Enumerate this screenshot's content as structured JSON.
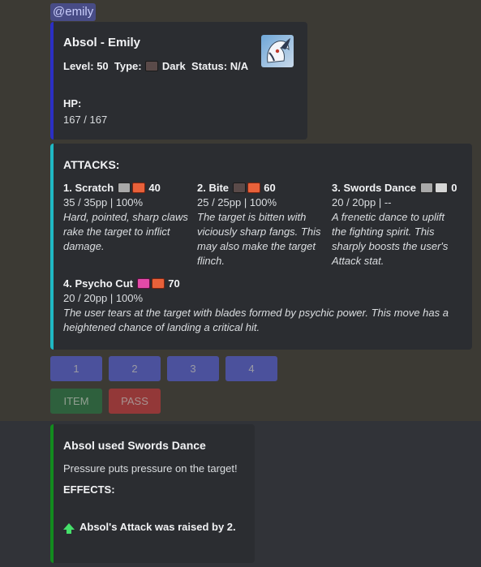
{
  "mention": "@emily",
  "status_card": {
    "title": "Absol - Emily",
    "level_label": "Level:",
    "level_value": "50",
    "type_label": "Type:",
    "type_value": "Dark",
    "status_label": "Status:",
    "status_value": "N/A",
    "hp_label": "HP:",
    "hp_value": "167 / 167"
  },
  "attacks_card": {
    "heading": "ATTACKS:",
    "attacks": [
      {
        "title": "1. Scratch",
        "power": "40",
        "pp": "35 / 35pp | 100%",
        "desc": "Hard, pointed, sharp claws rake the target to inflict damage.",
        "type_icon": "normal-type-icon",
        "category_icon": "physical-category-icon"
      },
      {
        "title": "2. Bite",
        "power": "60",
        "pp": "25 / 25pp | 100%",
        "desc": "The target is bitten with viciously sharp fangs. This may also make the target flinch.",
        "type_icon": "dark-type-icon",
        "category_icon": "physical-category-icon"
      },
      {
        "title": "3. Swords Dance",
        "power": "0",
        "pp": "20 / 20pp | --",
        "desc": "A frenetic dance to uplift the fighting spirit. This sharply boosts the user's Attack stat.",
        "type_icon": "normal-type-icon",
        "category_icon": "status-category-icon"
      },
      {
        "title": "4. Psycho Cut",
        "power": "70",
        "pp": "20 / 20pp | 100%",
        "desc": "The user tears at the target with blades formed by psychic power. This move has a heightened chance of landing a critical hit.",
        "type_icon": "psychic-type-icon",
        "category_icon": "physical-category-icon"
      }
    ]
  },
  "buttons": {
    "moves": [
      "1",
      "2",
      "3",
      "4"
    ],
    "item": "ITEM",
    "pass": "PASS"
  },
  "result_card": {
    "title": "Absol used Swords Dance",
    "line1": "Pressure puts pressure on the target!",
    "effects_label": "EFFECTS:",
    "effect": "Absol's Attack was raised by 2."
  },
  "colors": {
    "status_bar": "#2b2fc4",
    "attacks_bar": "#1fb8c4",
    "result_bar": "#128c1e",
    "move_button": "#5865f2",
    "item_button": "#248046",
    "pass_button": "#da373c"
  }
}
